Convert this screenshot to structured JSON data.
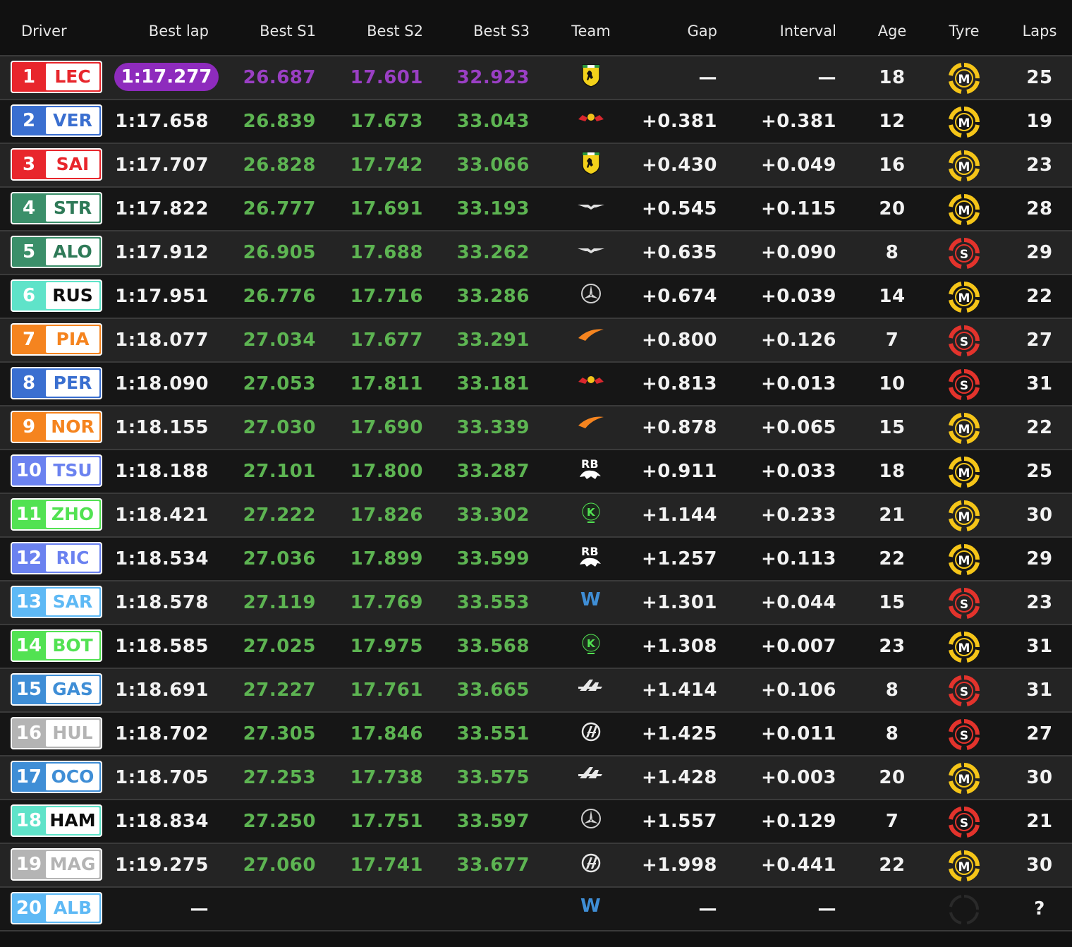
{
  "columns": {
    "driver": "Driver",
    "best_lap": "Best lap",
    "best_s1": "Best S1",
    "best_s2": "Best S2",
    "best_s3": "Best S3",
    "team": "Team",
    "gap": "Gap",
    "interval": "Interval",
    "age": "Age",
    "tyre": "Tyre",
    "laps": "Laps"
  },
  "colors": {
    "purple": "#8e2bbd",
    "green": "#5db452",
    "medium_tyre": "#f5c518",
    "soft_tyre": "#e3332c",
    "unknown_tyre": "#2a2a2a"
  },
  "drivers": [
    {
      "pos": "1",
      "abbr": "LEC",
      "color": "#e8262c",
      "text": "#e8262c",
      "best_lap": "1:17.277",
      "s1": "26.687",
      "s2": "17.601",
      "s3": "32.923",
      "team": "ferrari",
      "gap": "—",
      "interval": "—",
      "age": "18",
      "tyre": "M",
      "laps": "25",
      "fastest": true
    },
    {
      "pos": "2",
      "abbr": "VER",
      "color": "#3a6fd0",
      "text": "#3a6fd0",
      "best_lap": "1:17.658",
      "s1": "26.839",
      "s2": "17.673",
      "s3": "33.043",
      "team": "redbull",
      "gap": "+0.381",
      "interval": "+0.381",
      "age": "12",
      "tyre": "M",
      "laps": "19"
    },
    {
      "pos": "3",
      "abbr": "SAI",
      "color": "#e8262c",
      "text": "#e8262c",
      "best_lap": "1:17.707",
      "s1": "26.828",
      "s2": "17.742",
      "s3": "33.066",
      "team": "ferrari",
      "gap": "+0.430",
      "interval": "+0.049",
      "age": "16",
      "tyre": "M",
      "laps": "23"
    },
    {
      "pos": "4",
      "abbr": "STR",
      "color": "#3b8f6a",
      "text": "#2f7a58",
      "best_lap": "1:17.822",
      "s1": "26.777",
      "s2": "17.691",
      "s3": "33.193",
      "team": "astonmartin",
      "gap": "+0.545",
      "interval": "+0.115",
      "age": "20",
      "tyre": "M",
      "laps": "28"
    },
    {
      "pos": "5",
      "abbr": "ALO",
      "color": "#3b8f6a",
      "text": "#2f7a58",
      "best_lap": "1:17.912",
      "s1": "26.905",
      "s2": "17.688",
      "s3": "33.262",
      "team": "astonmartin",
      "gap": "+0.635",
      "interval": "+0.090",
      "age": "8",
      "tyre": "S",
      "laps": "29"
    },
    {
      "pos": "6",
      "abbr": "RUS",
      "color": "#5fe3c9",
      "text": "#0d0d0d",
      "best_lap": "1:17.951",
      "s1": "26.776",
      "s2": "17.716",
      "s3": "33.286",
      "team": "mercedes",
      "gap": "+0.674",
      "interval": "+0.039",
      "age": "14",
      "tyre": "M",
      "laps": "22"
    },
    {
      "pos": "7",
      "abbr": "PIA",
      "color": "#f5841f",
      "text": "#f5841f",
      "best_lap": "1:18.077",
      "s1": "27.034",
      "s2": "17.677",
      "s3": "33.291",
      "team": "mclaren",
      "gap": "+0.800",
      "interval": "+0.126",
      "age": "7",
      "tyre": "S",
      "laps": "27"
    },
    {
      "pos": "8",
      "abbr": "PER",
      "color": "#3a6fd0",
      "text": "#3a6fd0",
      "best_lap": "1:18.090",
      "s1": "27.053",
      "s2": "17.811",
      "s3": "33.181",
      "team": "redbull",
      "gap": "+0.813",
      "interval": "+0.013",
      "age": "10",
      "tyre": "S",
      "laps": "31"
    },
    {
      "pos": "9",
      "abbr": "NOR",
      "color": "#f5841f",
      "text": "#f5841f",
      "best_lap": "1:18.155",
      "s1": "27.030",
      "s2": "17.690",
      "s3": "33.339",
      "team": "mclaren",
      "gap": "+0.878",
      "interval": "+0.065",
      "age": "15",
      "tyre": "M",
      "laps": "22"
    },
    {
      "pos": "10",
      "abbr": "TSU",
      "color": "#6b82f0",
      "text": "#6b82f0",
      "best_lap": "1:18.188",
      "s1": "27.101",
      "s2": "17.800",
      "s3": "33.287",
      "team": "rb",
      "gap": "+0.911",
      "interval": "+0.033",
      "age": "18",
      "tyre": "M",
      "laps": "25"
    },
    {
      "pos": "11",
      "abbr": "ZHO",
      "color": "#52e252",
      "text": "#52e252",
      "best_lap": "1:18.421",
      "s1": "27.222",
      "s2": "17.826",
      "s3": "33.302",
      "team": "kick",
      "gap": "+1.144",
      "interval": "+0.233",
      "age": "21",
      "tyre": "M",
      "laps": "30"
    },
    {
      "pos": "12",
      "abbr": "RIC",
      "color": "#6b82f0",
      "text": "#6b82f0",
      "best_lap": "1:18.534",
      "s1": "27.036",
      "s2": "17.899",
      "s3": "33.599",
      "team": "rb",
      "gap": "+1.257",
      "interval": "+0.113",
      "age": "22",
      "tyre": "M",
      "laps": "29"
    },
    {
      "pos": "13",
      "abbr": "SAR",
      "color": "#5eb9f5",
      "text": "#5eb9f5",
      "best_lap": "1:18.578",
      "s1": "27.119",
      "s2": "17.769",
      "s3": "33.553",
      "team": "williams",
      "gap": "+1.301",
      "interval": "+0.044",
      "age": "15",
      "tyre": "S",
      "laps": "23"
    },
    {
      "pos": "14",
      "abbr": "BOT",
      "color": "#52e252",
      "text": "#52e252",
      "best_lap": "1:18.585",
      "s1": "27.025",
      "s2": "17.975",
      "s3": "33.568",
      "team": "kick",
      "gap": "+1.308",
      "interval": "+0.007",
      "age": "23",
      "tyre": "M",
      "laps": "31"
    },
    {
      "pos": "15",
      "abbr": "GAS",
      "color": "#3f8ed6",
      "text": "#3f8ed6",
      "best_lap": "1:18.691",
      "s1": "27.227",
      "s2": "17.761",
      "s3": "33.665",
      "team": "alpine",
      "gap": "+1.414",
      "interval": "+0.106",
      "age": "8",
      "tyre": "S",
      "laps": "31"
    },
    {
      "pos": "16",
      "abbr": "HUL",
      "color": "#b4b4b4",
      "text": "#b4b4b4",
      "best_lap": "1:18.702",
      "s1": "27.305",
      "s2": "17.846",
      "s3": "33.551",
      "team": "haas",
      "gap": "+1.425",
      "interval": "+0.011",
      "age": "8",
      "tyre": "S",
      "laps": "27"
    },
    {
      "pos": "17",
      "abbr": "OCO",
      "color": "#3f8ed6",
      "text": "#3f8ed6",
      "best_lap": "1:18.705",
      "s1": "27.253",
      "s2": "17.738",
      "s3": "33.575",
      "team": "alpine",
      "gap": "+1.428",
      "interval": "+0.003",
      "age": "20",
      "tyre": "M",
      "laps": "30"
    },
    {
      "pos": "18",
      "abbr": "HAM",
      "color": "#5fe3c9",
      "text": "#0d0d0d",
      "best_lap": "1:18.834",
      "s1": "27.250",
      "s2": "17.751",
      "s3": "33.597",
      "team": "mercedes",
      "gap": "+1.557",
      "interval": "+0.129",
      "age": "7",
      "tyre": "S",
      "laps": "21"
    },
    {
      "pos": "19",
      "abbr": "MAG",
      "color": "#b4b4b4",
      "text": "#b4b4b4",
      "best_lap": "1:19.275",
      "s1": "27.060",
      "s2": "17.741",
      "s3": "33.677",
      "team": "haas",
      "gap": "+1.998",
      "interval": "+0.441",
      "age": "22",
      "tyre": "M",
      "laps": "30"
    },
    {
      "pos": "20",
      "abbr": "ALB",
      "color": "#5eb9f5",
      "text": "#5eb9f5",
      "best_lap": "—",
      "s1": "",
      "s2": "",
      "s3": "",
      "team": "williams",
      "gap": "—",
      "interval": "—",
      "age": "",
      "tyre": "?",
      "laps": "?"
    }
  ]
}
